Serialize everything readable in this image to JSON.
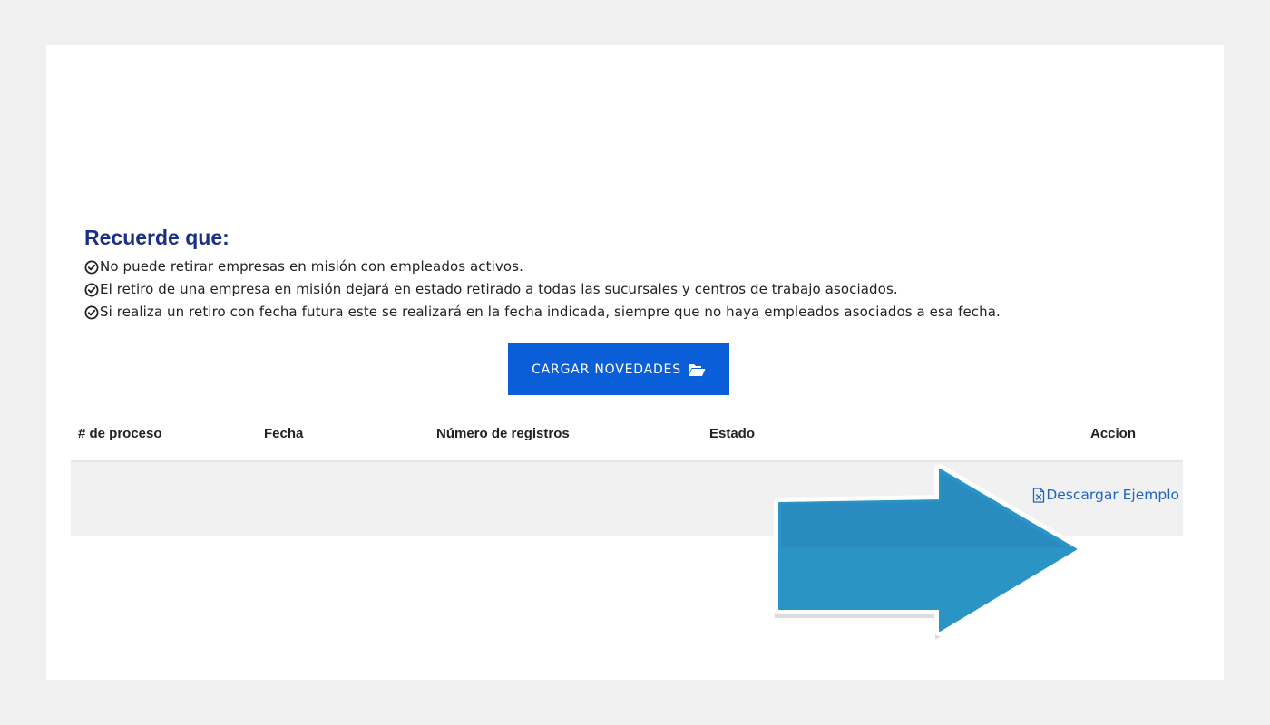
{
  "notice": {
    "title": "Recuerde que:",
    "items": [
      "No puede retirar empresas en misión con empleados activos.",
      "El retiro de una empresa en misión dejará en estado retirado a todas las sucursales y centros de trabajo asociados.",
      "Si realiza un retiro con fecha futura este se realizará en la fecha indicada, siempre que no haya empleados asociados a esa fecha."
    ],
    "item_icon": "check-circle-icon"
  },
  "upload": {
    "button_label": "CARGAR NOVEDADES",
    "icon": "folder-open-icon",
    "color": "#0a5fd8"
  },
  "table": {
    "columns": [
      "# de proceso",
      "Fecha",
      "Número de registros",
      "Estado",
      "Accion"
    ],
    "rows": [
      {
        "proceso": "",
        "fecha": "",
        "registros": "",
        "estado": "",
        "accion": {
          "label": "Descargar Ejemplo",
          "icon": "excel-file-icon"
        }
      }
    ]
  },
  "colors": {
    "title": "#1b2f86",
    "link": "#1e63c4",
    "arrow": "#2a95c4"
  }
}
